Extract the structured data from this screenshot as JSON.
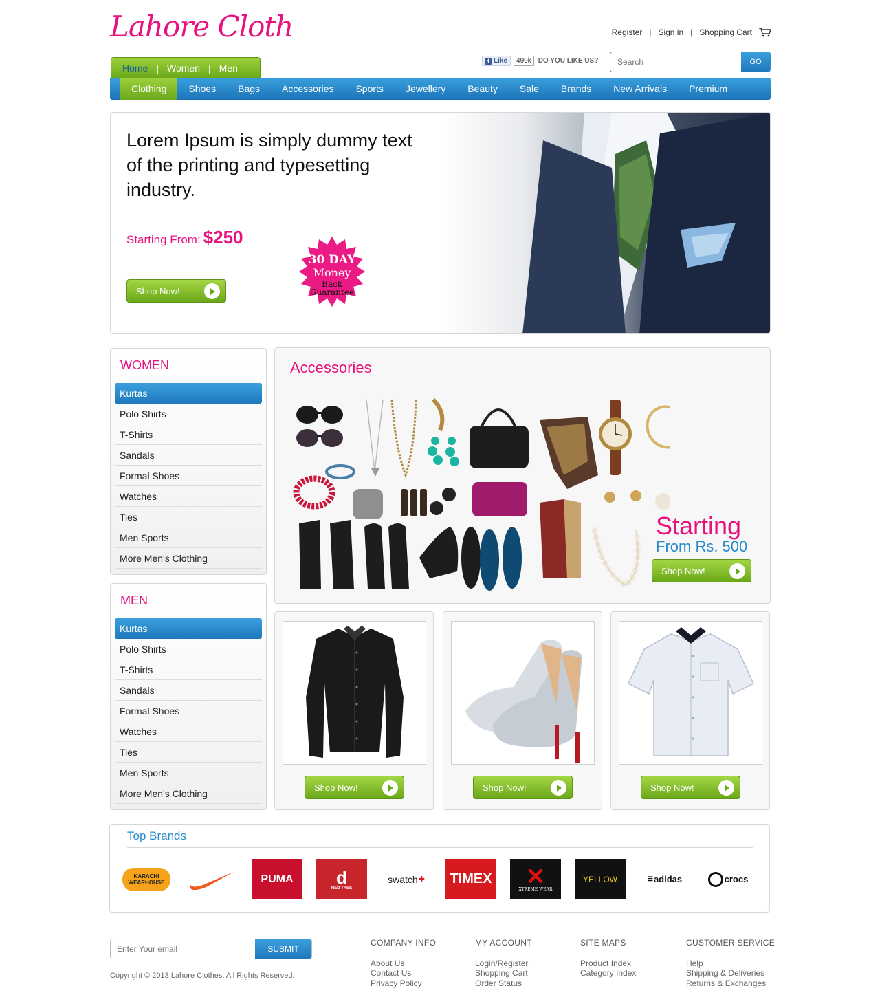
{
  "header": {
    "logo": "Lahore Cloth",
    "links": {
      "register": "Register",
      "signin": "Sign in",
      "cart": "Shopping Cart"
    },
    "pill_nav": [
      "Home",
      "Women",
      "Men"
    ],
    "facebook": {
      "like": "Like",
      "count": "499k",
      "ask": "DO YOU LIKE US?"
    },
    "search": {
      "placeholder": "Search",
      "button": "GO"
    }
  },
  "categories": [
    "Clothing",
    "Shoes",
    "Bags",
    "Accessories",
    "Sports",
    "Jewellery",
    "Beauty",
    "Sale",
    "Brands",
    "New Arrivals",
    "Premium"
  ],
  "hero": {
    "title": "Lorem Ipsum is simply dummy text of the printing and typesetting industry.",
    "from_label": "Starting From:",
    "price": "$250",
    "button": "Shop Now!",
    "badge": {
      "line1": "30 DAY",
      "line2": "Money",
      "line3": "Back",
      "line4": "Guarantee"
    }
  },
  "women": {
    "title": "WOMEN",
    "items": [
      "Kurtas",
      "Polo Shirts",
      "T-Shirts",
      "Sandals",
      "Formal Shoes",
      "Watches",
      "Ties",
      "Men Sports",
      "More Men's Clothing"
    ]
  },
  "men": {
    "title": "MEN",
    "items": [
      "Kurtas",
      "Polo Shirts",
      "T-Shirts",
      "Sandals",
      "Formal Shoes",
      "Watches",
      "Ties",
      "Men Sports",
      "More Men's Clothing"
    ]
  },
  "accessories": {
    "title": "Accessories",
    "starting": "Starting",
    "from": "From Rs. 500",
    "button": "Shop Now!"
  },
  "products": [
    {
      "button": "Shop Now!"
    },
    {
      "button": "Shop Now!"
    },
    {
      "button": "Shop Now!"
    }
  ],
  "brands": {
    "title": "Top Brands",
    "items": [
      "KARACHI WEARHOUSE",
      "nike",
      "PUMA",
      "RED TREE",
      "swatch",
      "TIMEX",
      "XTREME WEAR",
      "YELLOW",
      "adidas",
      "crocs"
    ]
  },
  "footer": {
    "email_placeholder": "Enter Your email",
    "submit": "SUBMIT",
    "copyright": "Copyright © 2013 Lahore Clothes. All Rights Reserved.",
    "columns": [
      {
        "title": "COMPANY INFO",
        "links": [
          "About Us",
          "Contact Us",
          "Privacy Policy"
        ]
      },
      {
        "title": "MY ACCOUNT",
        "links": [
          "Login/Register",
          "Shopping Cart",
          "Order Status"
        ]
      },
      {
        "title": "SITE MAPS",
        "links": [
          "Product Index",
          "Category Index"
        ]
      },
      {
        "title": "CUSTOMER SERVICE",
        "links": [
          "Help",
          "Shipping & Deliveries",
          "Returns & Exchanges"
        ]
      }
    ]
  },
  "colors": {
    "brand_pink": "#e6137f",
    "accent_blue": "#2a8ccc",
    "accent_green": "#7ab829"
  }
}
